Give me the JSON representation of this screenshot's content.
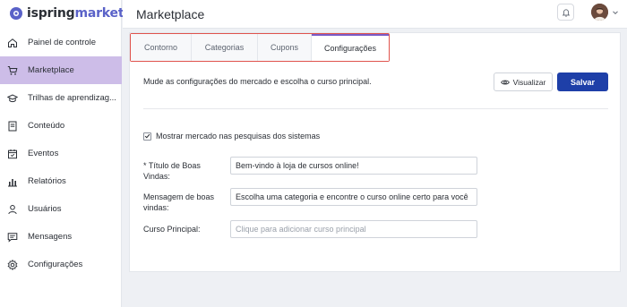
{
  "app": {
    "logo_part1": "ispring",
    "logo_part2": "market",
    "brand_color": "#5a62c8"
  },
  "sidebar": {
    "items": [
      {
        "label": "Painel de controle",
        "icon": "home-icon",
        "active": false
      },
      {
        "label": "Marketplace",
        "icon": "cart-icon",
        "active": true
      },
      {
        "label": "Trilhas de aprendizag...",
        "icon": "graduation-cap-icon",
        "active": false
      },
      {
        "label": "Conteúdo",
        "icon": "book-icon",
        "active": false
      },
      {
        "label": "Eventos",
        "icon": "calendar-icon",
        "active": false
      },
      {
        "label": "Relatórios",
        "icon": "bar-chart-icon",
        "active": false
      },
      {
        "label": "Usuários",
        "icon": "user-icon",
        "active": false
      },
      {
        "label": "Mensagens",
        "icon": "message-icon",
        "active": false
      },
      {
        "label": "Configurações",
        "icon": "gear-icon",
        "active": false
      }
    ]
  },
  "header": {
    "title": "Marketplace"
  },
  "tabs": [
    {
      "label": "Contorno",
      "active": false
    },
    {
      "label": "Categorias",
      "active": false
    },
    {
      "label": "Cupons",
      "active": false
    },
    {
      "label": "Configurações",
      "active": true
    }
  ],
  "settings": {
    "description": "Mude as configurações do mercado e escolha o curso principal.",
    "preview_label": "Visualizar",
    "save_label": "Salvar",
    "show_in_search_label": "Mostrar mercado nas pesquisas dos sistemas",
    "show_in_search_checked": true,
    "welcome_title_label": "* Título de Boas Vindas:",
    "welcome_title_value": "Bem-vindo à loja de cursos online!",
    "welcome_message_label": "Mensagem de boas vindas:",
    "welcome_message_value": "Escolha uma categoria e encontre o curso online certo para você",
    "main_course_label": "Curso Principal:",
    "main_course_placeholder": "Clique para adicionar curso principal"
  },
  "colors": {
    "sidebar_active": "#cdbde8",
    "primary_button": "#1e3fa8",
    "tab_highlight_border": "#e0534d",
    "active_tab_top": "#7a5cc7"
  }
}
